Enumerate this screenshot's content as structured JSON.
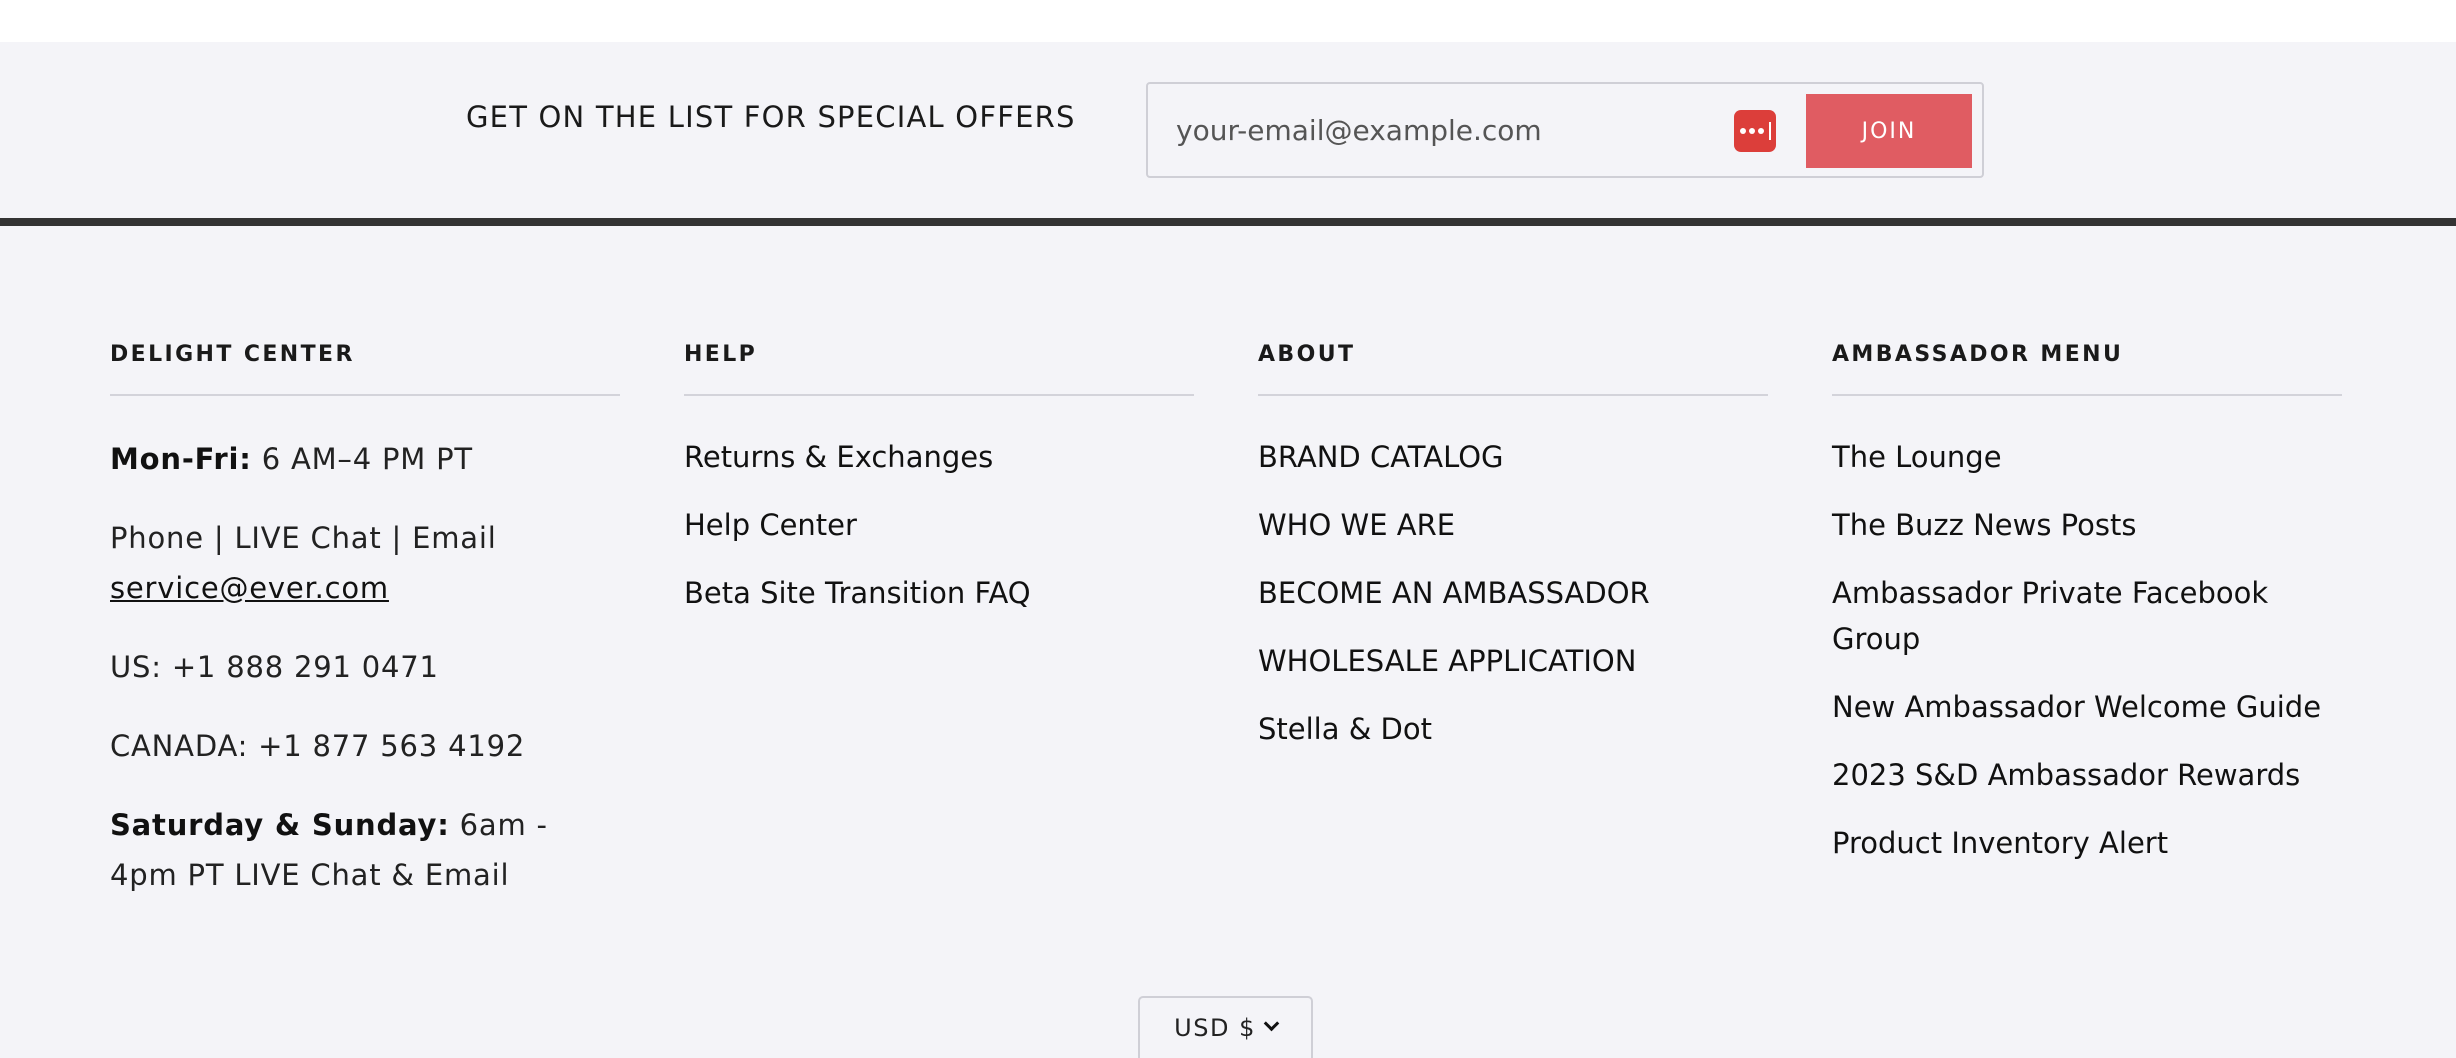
{
  "newsletter": {
    "title": "GET ON THE LIST FOR SPECIAL OFFERS",
    "email_placeholder": "your-email@example.com",
    "email_value": "",
    "password_manager_icon": "password-manager-icon",
    "join_label": "JOIN"
  },
  "colors": {
    "background": "#f4f4f8",
    "accent_button": "#e05c62",
    "password_manager": "#dc3e3a",
    "divider_dark": "#333333"
  },
  "footer": {
    "delight_center": {
      "heading": "DELIGHT CENTER",
      "hours_label": "Mon-Fri:",
      "hours_value": " 6 AM–4 PM PT",
      "channels": "Phone | LIVE Chat | Email",
      "email_link": "service@ever.com",
      "us_phone": "US: +1 888 291 0471",
      "canada_phone": "CANADA: +1 877 563 4192",
      "weekend_label": "Saturday & Sunday:",
      "weekend_value": " 6am - 4pm PT LIVE Chat & Email"
    },
    "help": {
      "heading": "HELP",
      "links": [
        "Returns & Exchanges",
        "Help Center",
        "Beta Site Transition FAQ"
      ]
    },
    "about": {
      "heading": "ABOUT",
      "links": [
        "BRAND CATALOG",
        "WHO WE ARE",
        "BECOME AN AMBASSADOR",
        "WHOLESALE APPLICATION",
        "Stella & Dot"
      ]
    },
    "ambassador_menu": {
      "heading": "AMBASSADOR MENU",
      "links": [
        "The Lounge",
        "The Buzz News Posts",
        "Ambassador Private Facebook Group",
        "New Ambassador Welcome Guide",
        "2023 S&D Ambassador Rewards",
        "Product Inventory Alert"
      ]
    }
  },
  "currency": {
    "selected": "USD $"
  }
}
